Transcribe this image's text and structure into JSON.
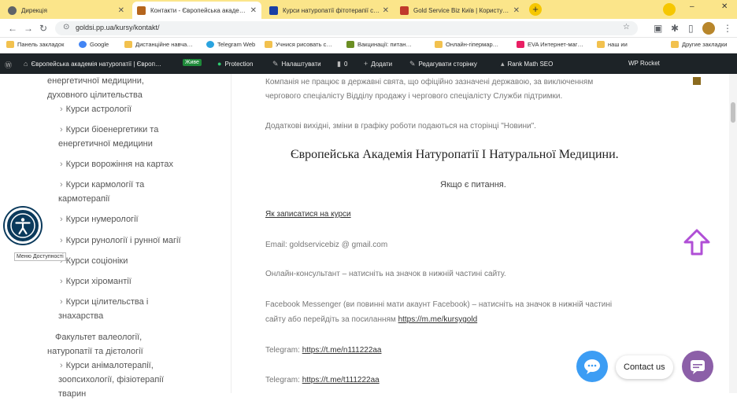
{
  "tabs": [
    {
      "title": "Дирекція",
      "color": "#5f6368"
    },
    {
      "title": "Контакти - Європейська акаде…",
      "color": "#b5651d"
    },
    {
      "title": "Курси натуропатії фітотерапії с…",
      "color": "#1a3fa5"
    },
    {
      "title": "Gold Service Biz Київ | Користу…",
      "color": "#c0392b"
    }
  ],
  "new_tab_label": "+",
  "window_controls": {
    "minimize": "–",
    "close": "✕"
  },
  "address": {
    "url": "goldsi.pp.ua/kursy/kontakt/"
  },
  "bookmarks": [
    {
      "label": "Панель закладок",
      "color": "#f2c14e"
    },
    {
      "label": "Google",
      "color": "#4285f4"
    },
    {
      "label": "Дистанційне навча…",
      "color": "#f2c14e"
    },
    {
      "label": "Telegram Web",
      "color": "#2aa3df"
    },
    {
      "label": "Учнися рисовать с…",
      "color": "#f2c14e"
    },
    {
      "label": "Вакцинації: питан…",
      "color": "#6b8e23"
    },
    {
      "label": "Онлайн-гіпермар…",
      "color": "#f2c14e"
    },
    {
      "label": "EVA Интернет-маг…",
      "color": "#e91e63"
    },
    {
      "label": "наш ии",
      "color": "#f2c14e"
    },
    {
      "label": "Другие закладки",
      "color": "#f2c14e"
    }
  ],
  "wp": {
    "site": "Європейська академія натуропатії | Європ…",
    "badge": "Живе",
    "items": [
      "Protection",
      "Налаштувати",
      "0",
      "Додати",
      "Редагувати сторінку",
      "Rank Math SEO",
      "WP Rocket"
    ]
  },
  "sidebar": [
    {
      "text": "енергетичної медицини,",
      "chev": false
    },
    {
      "text": "духовного цілительства",
      "chev": false
    },
    {
      "text": "Курси астрології",
      "chev": true
    },
    {
      "text": "Курси біоенергетики та",
      "chev": true
    },
    {
      "text": "енергетичної медицини",
      "chev": false
    },
    {
      "text": "Курси ворожіння на картах",
      "chev": true
    },
    {
      "text": "Курси кармології та",
      "chev": true
    },
    {
      "text": "кармотерапії",
      "chev": false
    },
    {
      "text": "Курси нумерології",
      "chev": true
    },
    {
      "text": "Курси рунології і рунної магії",
      "chev": true
    },
    {
      "text": "Курси соціоніки",
      "chev": true
    },
    {
      "text": "Курси хіромантії",
      "chev": true
    },
    {
      "text": "Курси цілительства і",
      "chev": true
    },
    {
      "text": "знахарства",
      "chev": false
    },
    {
      "text": "Факультет валеології,",
      "chev": false
    },
    {
      "text": "натуропатії та дієтології",
      "chev": false
    },
    {
      "text": "Курси анімалотерапії,",
      "chev": true
    },
    {
      "text": "зоопсихології, фізіотерапії",
      "chev": false
    },
    {
      "text": "тварин",
      "chev": false
    }
  ],
  "main": {
    "p1_l1": "Компанія не працює в державні свята, що офіційно зазначені державою, за виключенням",
    "p1_l2": "чергового спеціалісту Відділу продажу і чергового спеціалісту Служби підтримки.",
    "p2": "Додаткові вихідні, зміни в графіку роботи подаються на сторінці \"Новини\".",
    "heading": "Європейська Академія Натуропатії І Натуральної Медицини.",
    "subheading": "Якщо є питання.",
    "enroll_link": "Як записатися на курси",
    "email": "Email: goldservicebiz @ gmail.com",
    "consultant": "Онлайн-консультант – натисніть на значок в нижній частині сайту.",
    "messenger_l1": "Facebook Messenger (ви повинні мати акаунт Facebook) – натисніть на значок в нижній частині",
    "messenger_l2_prefix": "сайту або перейдіть за посиланням ",
    "messenger_link": "https://m.me/kursygold",
    "telegram1_prefix": "Telegram: ",
    "telegram1_link": "https://t.me/n111222aa",
    "telegram2_prefix": "Telegram: ",
    "telegram2_link": "https://t.me/t111222aa"
  },
  "accessibility_tooltip": "Меню Доступності",
  "contact_label": "Contact us",
  "colors": {
    "accent_yellow": "#fbe58a",
    "wp_bar": "#1d2327",
    "accessibility": "#0b3a5c",
    "arrow": "#b04fd6",
    "chat_blue": "#3c9df4",
    "chat_purple": "#8c5fa8"
  }
}
